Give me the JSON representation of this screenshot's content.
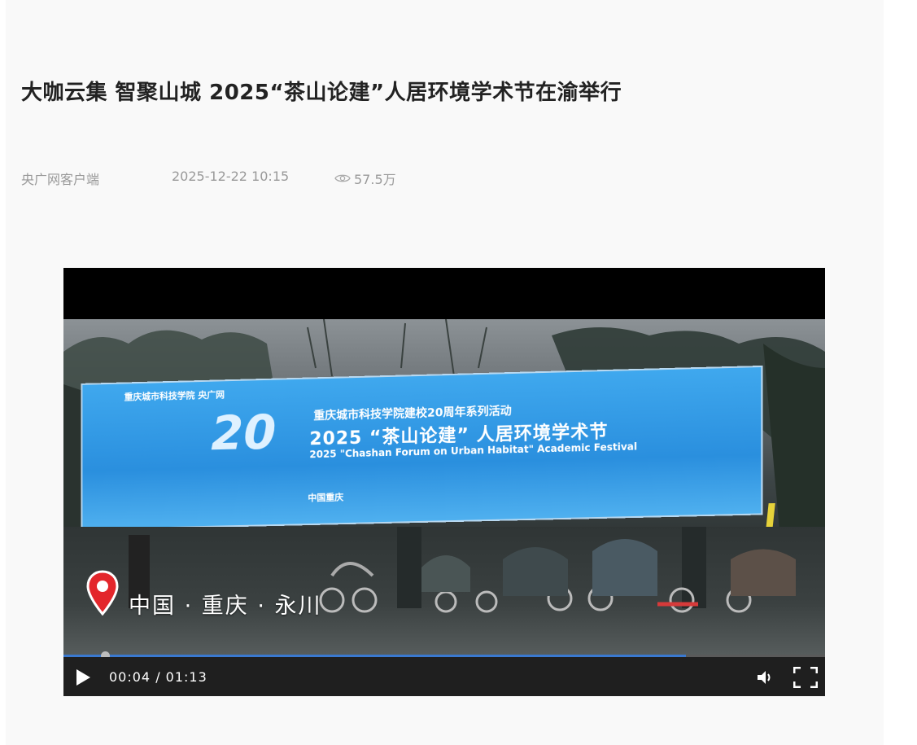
{
  "article": {
    "title": "大咖云集 智聚山城 2025“茶山论建”人居环境学术节在渝举行",
    "source": "央广网客户端",
    "time": "2025-12-22 10:15",
    "views": "57.5万",
    "icons": {
      "views": "eye-icon"
    }
  },
  "video": {
    "billboard": {
      "logo": "重庆城市科技学院  央广网",
      "number": "20",
      "line1": "重庆城市科技学院建校20周年系列活动",
      "line2": "2025 “茶山论建” 人居环境学术节",
      "line3": "2025 \"Chashan Forum on Urban Habitat\" Academic Festival",
      "location": "中国重庆"
    },
    "location_overlay": "中国 · 重庆 · 永川",
    "controls": {
      "time_display": "00:04 / 01:13",
      "progress_fraction": 0.055,
      "buffered_fraction": 0.817,
      "icons": {
        "play": "play-icon",
        "volume": "volume-icon",
        "fullscreen": "fullscreen-icon",
        "location": "location-pin-icon"
      }
    }
  },
  "colors": {
    "accent": "#3a79d0",
    "pin": "#e3262b",
    "billboard": "#2a8fde"
  }
}
